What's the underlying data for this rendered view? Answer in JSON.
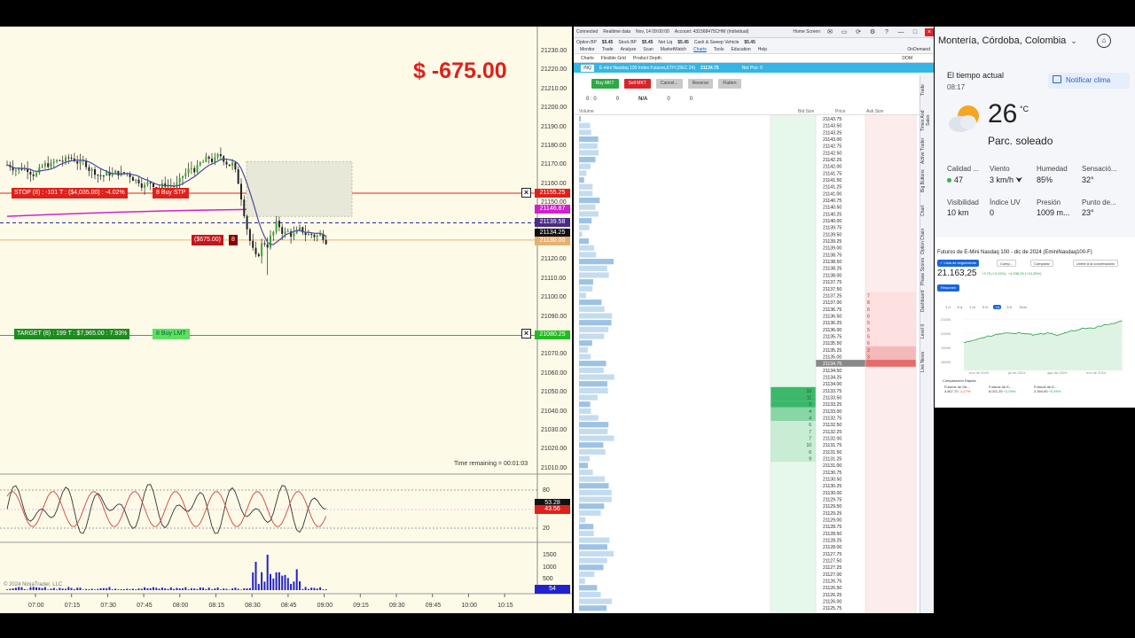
{
  "chart": {
    "pnl": "$ -675.00",
    "stop_label": "STOP (8) : -101 T : ($4,035.00) : -4.02%",
    "stop_button": "8 Buy STP",
    "target_label": "TARGET (8) : 199 T : $7,965.00 : 7.93%",
    "target_button": "8 Buy LMT",
    "position_pnl": "($675.00)",
    "position_qty": "8",
    "time_remaining": "Time remaining = 00:01:03",
    "copyright": "© 2024 NinjaTrader, LLC",
    "price_axis": [
      "21230.00",
      "21220.00",
      "21210.00",
      "21200.00",
      "21190.00",
      "21180.00",
      "21170.00",
      "21160.00",
      "21150.00",
      "21140.00",
      "21130.00",
      "21120.00",
      "21110.00",
      "21100.00",
      "21090.00",
      "21080.00",
      "21070.00",
      "21060.00",
      "21050.00",
      "21040.00",
      "21030.00",
      "21020.00",
      "21010.00"
    ],
    "price_tags": [
      {
        "text": "21155.25",
        "color": "#e0201a"
      },
      {
        "text": "21146.87",
        "color": "#d020d0"
      },
      {
        "text": "21139.58",
        "color": "#4a2c86"
      },
      {
        "text": "21134.25",
        "color": "#111111"
      },
      {
        "text": "21130.00",
        "color": "#e8b070"
      },
      {
        "text": "21080.25",
        "color": "#22bb22"
      }
    ],
    "osc_axis": [
      "80",
      "20"
    ],
    "osc_tags": [
      {
        "text": "53.28",
        "color": "#111111"
      },
      {
        "text": "43.56",
        "color": "#e0201a"
      }
    ],
    "vol_axis": [
      "1500",
      "1000",
      "500"
    ],
    "vol_tag": "54",
    "time_axis": [
      "07:00",
      "07:15",
      "07:30",
      "07:45",
      "08:00",
      "08:15",
      "08:30",
      "08:45",
      "09:00",
      "09:15",
      "09:30",
      "09:45",
      "10:00",
      "10:15"
    ]
  },
  "dom": {
    "topbar": [
      "Connected",
      "Realtime data",
      "Nov, 14 09:00:00",
      "Account: 431568475CHW (Individual)",
      "Home Screen"
    ],
    "row2": [
      "Option BP",
      "$5.45",
      "Stock BP",
      "$5.45",
      "Net Liq",
      "$5.45",
      "Cash & Sweep Vehicle",
      "$5.45"
    ],
    "menu": [
      "Monitor",
      "Trade",
      "Analyze",
      "Scan",
      "MarketWatch",
      "Charts",
      "Tools",
      "Education",
      "Help"
    ],
    "on_demand": "OnDemand",
    "subtabs": [
      "Charts",
      "Flexible Grid",
      "Product Depth"
    ],
    "dom_label": "DOM",
    "symbol": "/NQ",
    "symbol_desc": "E-mini Nasdaq 100 Index Futures,ETH (DEC 24)",
    "last_price": "21134.75",
    "net_pos": "Net Pos: 0",
    "buttons": {
      "buy": "Buy MKT",
      "sell": "Sell MKT",
      "cancel": "Cancel...",
      "reverse": "Reverse",
      "flatten": "Flatten"
    },
    "stats": [
      "0 : 0",
      "0",
      "N/A",
      "0",
      "0"
    ],
    "headers": {
      "volume": "Volume",
      "bid": "Bid Size",
      "price": "Price",
      "ask": "Ask Size"
    },
    "ladder_top": "21143.75",
    "current_price": "21134.75",
    "ask_sizes": [
      "7",
      "8",
      "6",
      "6",
      "5",
      "5",
      "5",
      "6",
      "3",
      "3",
      "3"
    ],
    "bid_sizes": [
      "10",
      "11",
      "3",
      "4",
      "4",
      "6",
      "7",
      "7",
      "10",
      "6",
      "9"
    ],
    "side_tabs": [
      "Trade",
      "Times And Sales",
      "Active Trader",
      "Big Buttons",
      "Chart",
      "Option Chain",
      "Phase Scores",
      "Dashboard",
      "Level II",
      "Live News"
    ]
  },
  "weather": {
    "location": "Montería, Córdoba, Colombia",
    "title": "El tiempo actual",
    "time": "08:17",
    "notify": "Notificar clima",
    "temp": "26",
    "unit": "°C",
    "condition": "Parc. soleado",
    "metrics": [
      {
        "label": "Calidad ...",
        "value": "47"
      },
      {
        "label": "Viento",
        "value": "3 km/h"
      },
      {
        "label": "Humedad",
        "value": "85%"
      },
      {
        "label": "Sensació...",
        "value": "32°"
      },
      {
        "label": "Visibilidad",
        "value": "10 km"
      },
      {
        "label": "Índice UV",
        "value": "0"
      },
      {
        "label": "Presión",
        "value": "1009 m..."
      },
      {
        "label": "Punto de...",
        "value": "23°"
      }
    ]
  },
  "stock": {
    "title": "Futuros de E-Mini Nasdaq 100 - dic de 2024 (EminiNasdaq100-F)",
    "price": "21.163,25",
    "change1": "+3,75 (+0,02%)",
    "change2": "+4.538,25 (+24,35%)",
    "follow": "Lista de seguimiento",
    "buttons": [
      "Comp...",
      "Comparar",
      "Unirte a la conversación"
    ],
    "summary": "Resumen",
    "ranges": [
      "1 d",
      "5 d",
      "1 m",
      "3 m",
      "1A",
      "5 A",
      "Todo"
    ],
    "selected_range": "1A",
    "chart_xlabels": [
      "nov de 2024",
      "jul de 2024",
      "ago de 2024",
      "nov de 2024"
    ],
    "chart_ylabels": [
      "21000",
      "20000",
      "19000",
      "18000"
    ],
    "compare_title": "Comparación Rápida",
    "compare": [
      {
        "name": "Futuros de S&...",
        "value": "4.607,70",
        "change": "-1,17%"
      },
      {
        "name": "Futuros de E-...",
        "value": "6.021,25",
        "change": "+2,09%"
      },
      {
        "name": "Futuros de E-...",
        "value": "2.394,90",
        "change": "+0,49%"
      }
    ]
  }
}
